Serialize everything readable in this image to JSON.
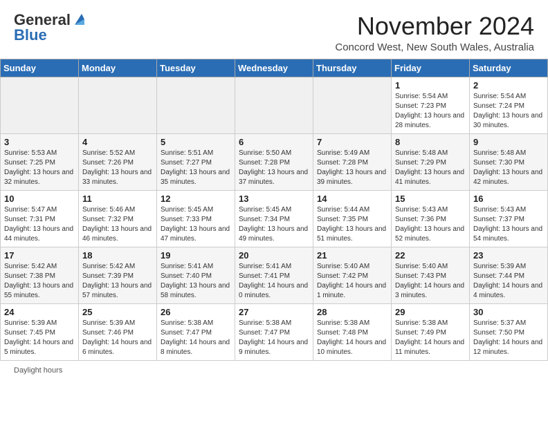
{
  "header": {
    "logo_general": "General",
    "logo_blue": "Blue",
    "month_title": "November 2024",
    "location": "Concord West, New South Wales, Australia"
  },
  "calendar": {
    "days_of_week": [
      "Sunday",
      "Monday",
      "Tuesday",
      "Wednesday",
      "Thursday",
      "Friday",
      "Saturday"
    ],
    "weeks": [
      [
        {
          "day": "",
          "info": ""
        },
        {
          "day": "",
          "info": ""
        },
        {
          "day": "",
          "info": ""
        },
        {
          "day": "",
          "info": ""
        },
        {
          "day": "",
          "info": ""
        },
        {
          "day": "1",
          "info": "Sunrise: 5:54 AM\nSunset: 7:23 PM\nDaylight: 13 hours and 28 minutes."
        },
        {
          "day": "2",
          "info": "Sunrise: 5:54 AM\nSunset: 7:24 PM\nDaylight: 13 hours and 30 minutes."
        }
      ],
      [
        {
          "day": "3",
          "info": "Sunrise: 5:53 AM\nSunset: 7:25 PM\nDaylight: 13 hours and 32 minutes."
        },
        {
          "day": "4",
          "info": "Sunrise: 5:52 AM\nSunset: 7:26 PM\nDaylight: 13 hours and 33 minutes."
        },
        {
          "day": "5",
          "info": "Sunrise: 5:51 AM\nSunset: 7:27 PM\nDaylight: 13 hours and 35 minutes."
        },
        {
          "day": "6",
          "info": "Sunrise: 5:50 AM\nSunset: 7:28 PM\nDaylight: 13 hours and 37 minutes."
        },
        {
          "day": "7",
          "info": "Sunrise: 5:49 AM\nSunset: 7:28 PM\nDaylight: 13 hours and 39 minutes."
        },
        {
          "day": "8",
          "info": "Sunrise: 5:48 AM\nSunset: 7:29 PM\nDaylight: 13 hours and 41 minutes."
        },
        {
          "day": "9",
          "info": "Sunrise: 5:48 AM\nSunset: 7:30 PM\nDaylight: 13 hours and 42 minutes."
        }
      ],
      [
        {
          "day": "10",
          "info": "Sunrise: 5:47 AM\nSunset: 7:31 PM\nDaylight: 13 hours and 44 minutes."
        },
        {
          "day": "11",
          "info": "Sunrise: 5:46 AM\nSunset: 7:32 PM\nDaylight: 13 hours and 46 minutes."
        },
        {
          "day": "12",
          "info": "Sunrise: 5:45 AM\nSunset: 7:33 PM\nDaylight: 13 hours and 47 minutes."
        },
        {
          "day": "13",
          "info": "Sunrise: 5:45 AM\nSunset: 7:34 PM\nDaylight: 13 hours and 49 minutes."
        },
        {
          "day": "14",
          "info": "Sunrise: 5:44 AM\nSunset: 7:35 PM\nDaylight: 13 hours and 51 minutes."
        },
        {
          "day": "15",
          "info": "Sunrise: 5:43 AM\nSunset: 7:36 PM\nDaylight: 13 hours and 52 minutes."
        },
        {
          "day": "16",
          "info": "Sunrise: 5:43 AM\nSunset: 7:37 PM\nDaylight: 13 hours and 54 minutes."
        }
      ],
      [
        {
          "day": "17",
          "info": "Sunrise: 5:42 AM\nSunset: 7:38 PM\nDaylight: 13 hours and 55 minutes."
        },
        {
          "day": "18",
          "info": "Sunrise: 5:42 AM\nSunset: 7:39 PM\nDaylight: 13 hours and 57 minutes."
        },
        {
          "day": "19",
          "info": "Sunrise: 5:41 AM\nSunset: 7:40 PM\nDaylight: 13 hours and 58 minutes."
        },
        {
          "day": "20",
          "info": "Sunrise: 5:41 AM\nSunset: 7:41 PM\nDaylight: 14 hours and 0 minutes."
        },
        {
          "day": "21",
          "info": "Sunrise: 5:40 AM\nSunset: 7:42 PM\nDaylight: 14 hours and 1 minute."
        },
        {
          "day": "22",
          "info": "Sunrise: 5:40 AM\nSunset: 7:43 PM\nDaylight: 14 hours and 3 minutes."
        },
        {
          "day": "23",
          "info": "Sunrise: 5:39 AM\nSunset: 7:44 PM\nDaylight: 14 hours and 4 minutes."
        }
      ],
      [
        {
          "day": "24",
          "info": "Sunrise: 5:39 AM\nSunset: 7:45 PM\nDaylight: 14 hours and 5 minutes."
        },
        {
          "day": "25",
          "info": "Sunrise: 5:39 AM\nSunset: 7:46 PM\nDaylight: 14 hours and 6 minutes."
        },
        {
          "day": "26",
          "info": "Sunrise: 5:38 AM\nSunset: 7:47 PM\nDaylight: 14 hours and 8 minutes."
        },
        {
          "day": "27",
          "info": "Sunrise: 5:38 AM\nSunset: 7:47 PM\nDaylight: 14 hours and 9 minutes."
        },
        {
          "day": "28",
          "info": "Sunrise: 5:38 AM\nSunset: 7:48 PM\nDaylight: 14 hours and 10 minutes."
        },
        {
          "day": "29",
          "info": "Sunrise: 5:38 AM\nSunset: 7:49 PM\nDaylight: 14 hours and 11 minutes."
        },
        {
          "day": "30",
          "info": "Sunrise: 5:37 AM\nSunset: 7:50 PM\nDaylight: 14 hours and 12 minutes."
        }
      ]
    ]
  },
  "footer": {
    "daylight_label": "Daylight hours"
  }
}
